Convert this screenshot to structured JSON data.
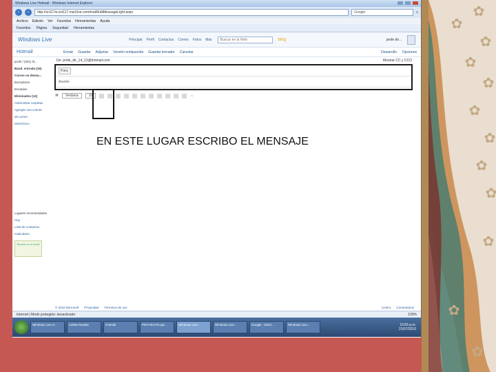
{
  "browser": {
    "window_title": "Windows Live Hotmail - Windows Internet Explorer",
    "address": "http://sn117w.snt117.mail.live.com/mail/EditMessageLight.aspx",
    "search_placeholder": "Google",
    "menu": [
      "Archivo",
      "Edición",
      "Ver",
      "Favoritos",
      "Herramientas",
      "Ayuda"
    ],
    "favorites_bar": [
      "Favoritos",
      "Página",
      "Seguridad",
      "Herramientas"
    ],
    "status_text": "Internet | Modo protegido: desactivado",
    "zoom": "100%"
  },
  "live_header": {
    "logo": "Windows Live",
    "nav": [
      "Principal",
      "Perfil",
      "Contactos",
      "Correo",
      "Fotos",
      "Más"
    ],
    "search_placeholder": "Buscar en la Web",
    "search_brand": "bing",
    "user": "profe dir..."
  },
  "hotmail_bar": {
    "logo": "Hotmail",
    "actions": [
      "Enviar",
      "Guardar",
      "Adjuntar",
      "Versión enriquecida",
      "Guardar borrador",
      "Cancelar"
    ],
    "right_actions": [
      "Desarrollo",
      "Opciones"
    ]
  },
  "sidebar": {
    "account": "profe / (001) lit...",
    "items": [
      "Band. entrada (15)",
      "Correo no desea...",
      "Borradores",
      "Enviados",
      "Eliminados (12)",
      "Administrar carpetas",
      "Agregar una cuenta",
      "de correo",
      "electrónico"
    ],
    "lower_items": [
      "Lugares recomendados",
      "Hoy",
      "Lista de contactos",
      "Calendario"
    ],
    "promo": "Tenerlo en el móvil"
  },
  "compose": {
    "from": "De: profe_dir_14_13@hotmail.com",
    "to_label": "Para",
    "to_value": "",
    "subject_label": "Asunto",
    "subject_value": "",
    "date_hint": "Mostrar CC y CCO",
    "font_select": "Verdana",
    "size_select": "10",
    "message_instruction": "EN ESTE LUGAR ESCRIBO EL MENSAJE"
  },
  "footer": {
    "left": [
      "© 2010 Microsoft",
      "Privacidad",
      "Términos de uso"
    ],
    "right": [
      "Centro",
      "Comentarios"
    ]
  },
  "taskbar": {
    "items": [
      "Windows Live H...",
      "Adobe Reader",
      "Hotmail",
      "PROYECTO.ppt...",
      "Windows Live...",
      "Windows Live...",
      "Google - Wind...",
      "Windows Live...",
      "Microsoft Pow..."
    ],
    "time": "10:55 p.m.",
    "date": "21/07/2010"
  }
}
